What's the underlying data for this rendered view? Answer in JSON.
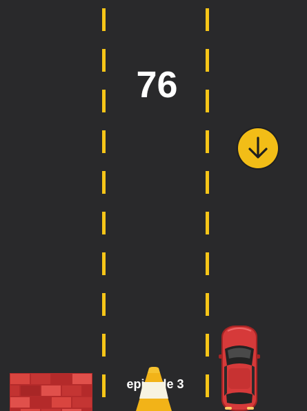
{
  "game": {
    "score": "76",
    "episode_label": "episode 3"
  },
  "colors": {
    "road": "#29292b",
    "lane_marking": "#f6c518",
    "powerup": "#f2bd17",
    "car": "#d63a3a",
    "brick": "#d9453f",
    "cone": "#f2b318"
  },
  "icons": {
    "powerup": "arrow-down-icon",
    "player": "red-car-icon",
    "obstacles": [
      "brick-wall-icon",
      "traffic-cone-icon"
    ]
  }
}
